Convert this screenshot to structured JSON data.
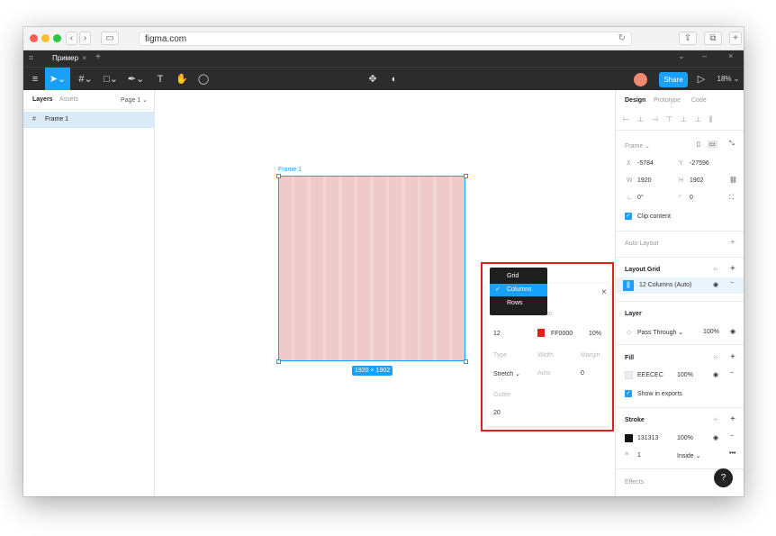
{
  "browser": {
    "url": "figma.com"
  },
  "figma": {
    "tab_title": "Пример",
    "zoom": "18%",
    "share_label": "Share"
  },
  "left_panel": {
    "tabs": [
      "Layers",
      "Assets"
    ],
    "page": "Page 1",
    "layers": [
      {
        "label": "Frame 1"
      }
    ]
  },
  "canvas": {
    "frame_label": "Frame 1",
    "frame_size": "1920 × 1902",
    "grid_columns": 12,
    "grid_color": "#FF0000"
  },
  "grid_popover": {
    "dropdown": [
      "Grid",
      "Columns",
      "Rows"
    ],
    "selected": "Columns",
    "count_label": "Count",
    "color_label": "Color",
    "count": "12",
    "color_hex": "FF0000",
    "opacity": "10%",
    "type_label": "Type",
    "width_label": "Width",
    "margin_label": "Margin",
    "type": "Stretch",
    "width": "Auto",
    "margin": "0",
    "gutter_label": "Gutter",
    "gutter": "20"
  },
  "right_panel": {
    "tabs": [
      "Design",
      "Prototype",
      "Code"
    ],
    "frame_label": "Frame",
    "x_label": "X",
    "x": "-5784",
    "y_label": "Y",
    "y": "-27596",
    "w_label": "W",
    "w": "1920",
    "h_label": "H",
    "h": "1902",
    "rotation": "0°",
    "radius": "0",
    "clip_content": "Clip content",
    "auto_layout": "Auto Layout",
    "layout_grid": "Layout Grid",
    "layout_grid_item": "12 Columns (Auto)",
    "layer": "Layer",
    "blend": "Pass Through",
    "layer_opacity": "100%",
    "fill": "Fill",
    "fill_hex": "EEECEC",
    "fill_opacity": "100%",
    "show_exports": "Show in exports",
    "stroke": "Stroke",
    "stroke_hex": "131313",
    "stroke_opacity": "100%",
    "stroke_weight": "1",
    "stroke_position": "Inside",
    "effects": "Effects",
    "help": "?"
  }
}
